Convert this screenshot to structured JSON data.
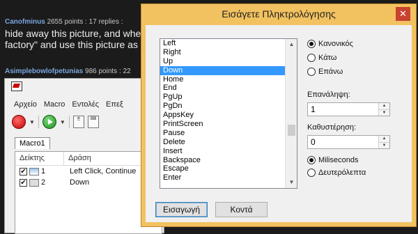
{
  "forum": {
    "post1": {
      "user": "Canofminus",
      "meta": "2655 points : 17 replies :"
    },
    "post1_body": {
      "line1": "hide away this picture, and whe",
      "line2": "factory\" and use this picture as"
    },
    "post2": {
      "user": "Asimplebowlofpetunias",
      "meta": "986 points : 22"
    }
  },
  "app": {
    "menu": [
      "Αρχείο",
      "Macro",
      "Εντολές",
      "Επεξ"
    ],
    "tab": "Macro1",
    "columns": {
      "index": "Δείκτης",
      "action": "Δράση"
    },
    "rows": [
      {
        "index": "1",
        "action": "Left Click, Continue",
        "checked": true
      },
      {
        "index": "2",
        "action": "Down",
        "checked": true
      }
    ]
  },
  "dialog": {
    "title": "Εισάγετε Πληκτρολόγησης",
    "close_label": "✕",
    "keys": [
      "Left",
      "Right",
      "Up",
      "Down",
      "Home",
      "End",
      "PgUp",
      "PgDn",
      "AppsKey",
      "PrintScreen",
      "Pause",
      "Delete",
      "Insert",
      "Backspace",
      "Escape",
      "Enter"
    ],
    "selected_key": "Down",
    "mode_options": [
      {
        "label": "Κανονικός",
        "selected": true
      },
      {
        "label": "Κάτω",
        "selected": false
      },
      {
        "label": "Επάνω",
        "selected": false
      }
    ],
    "repeat_label": "Επανάληψη:",
    "repeat_value": "1",
    "delay_label": "Καθυστέρηση:",
    "delay_value": "0",
    "unit_options": [
      {
        "label": "Miliseconds",
        "selected": true
      },
      {
        "label": "Δευτερόλεπτα",
        "selected": false
      }
    ],
    "insert_button": "Εισαγωγή",
    "close_button": "Κοντά"
  },
  "colors": {
    "titlebar": "#f2c260",
    "close": "#c7432f",
    "selection": "#3399ff",
    "forum_user": "#7aa6e0"
  }
}
